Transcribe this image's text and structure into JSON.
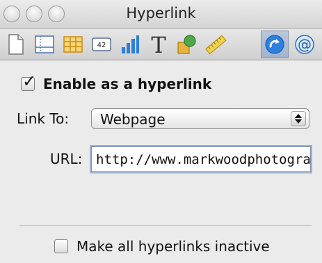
{
  "window": {
    "title": "Hyperlink"
  },
  "toolbar": {
    "items": [
      {
        "name": "document-inspector",
        "icon": "page-icon"
      },
      {
        "name": "layout-inspector",
        "icon": "layout-icon"
      },
      {
        "name": "table-inspector",
        "icon": "table-icon"
      },
      {
        "name": "format-inspector",
        "icon": "number-format-icon",
        "text": "42"
      },
      {
        "name": "chart-inspector",
        "icon": "bar-chart-icon"
      },
      {
        "name": "text-inspector",
        "icon": "text-icon",
        "text": "T"
      },
      {
        "name": "graphic-inspector",
        "icon": "shapes-icon"
      },
      {
        "name": "metrics-inspector",
        "icon": "ruler-icon"
      },
      {
        "name": "hyperlink-inspector",
        "icon": "hyperlink-arrow-icon",
        "active": true
      },
      {
        "name": "quicktime-inspector",
        "icon": "at-sign-icon",
        "text": "@"
      }
    ]
  },
  "hyperlink": {
    "enable_label": "Enable as a hyperlink",
    "enable_checked": true,
    "link_to_label": "Link To:",
    "link_to_value": "Webpage",
    "url_label": "URL:",
    "url_value": "http://www.markwoodphotography.com",
    "inactive_label": "Make all hyperlinks inactive",
    "inactive_checked": false
  },
  "colors": {
    "active_tab": "#a9bad0",
    "focus_ring": "#9fb4d3"
  }
}
